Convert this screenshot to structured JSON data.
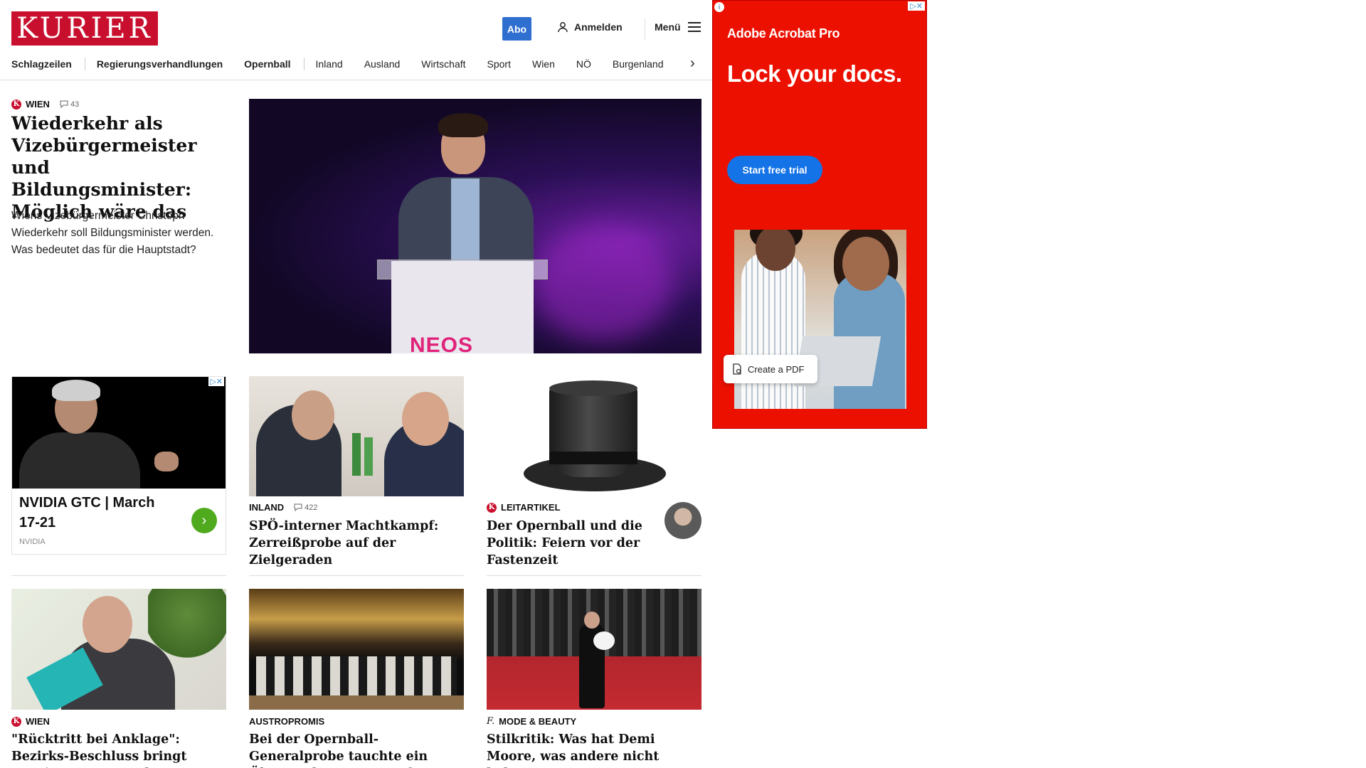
{
  "header": {
    "logo_text": "KURIER",
    "abo_label": "Abo",
    "login_label": "Anmelden",
    "menu_label": "Menü",
    "brand_color": "#c8102e"
  },
  "nav": {
    "items": [
      "Schlagzeilen",
      "Regierungsverhandlungen",
      "Opernball",
      "Inland",
      "Ausland",
      "Wirtschaft",
      "Sport",
      "Wien",
      "NÖ",
      "Burgenland"
    ]
  },
  "lead": {
    "section": "WIEN",
    "comments": "43",
    "title": "Wiederkehr als Vizebürgermeister und Bildungsminister: Möglich wäre das",
    "teaser": "Wiens Vizebürgermeister Christoph Wiederkehr soll Bildungsminister werden. Was bedeutet das für die Hauptstadt?",
    "image_text": "NEOS"
  },
  "ad_left": {
    "title": "NVIDIA GTC | March 17-21",
    "brand": "NVIDIA",
    "adchoices": "▷✕"
  },
  "cards": [
    {
      "section": "INLAND",
      "comments": "422",
      "title": "SPÖ-interner Machtkampf: Zerreißprobe auf der Zielgeraden"
    },
    {
      "section": "LEITARTIKEL",
      "title": "Der Opernball und die Politik: Feiern vor der Fastenzeit"
    },
    {
      "section": "WIEN",
      "title": "\"Rücktritt bei Anklage\": Bezirks-Beschluss bringt Nevrivy unter Druck"
    },
    {
      "section": "AUSTROPROMIS",
      "title": "Bei der Opernball-Generalprobe tauchte ein Überraschungsgast auf"
    },
    {
      "section": "MODE & BEAUTY",
      "title": "Stilkritik: Was hat Demi Moore, was andere nicht haben?"
    }
  ],
  "ad_right": {
    "brand": "Adobe Acrobat Pro",
    "headline": "Lock your docs.",
    "cta": "Start free trial",
    "pdf_label": "Create a PDF",
    "adchoices": "▷✕",
    "background_color": "#eb1000",
    "cta_color": "#1473e6"
  },
  "icons": {
    "user": "user-icon",
    "menu": "hamburger-icon",
    "comment": "comment-icon",
    "chevron": "chevron-right-icon"
  }
}
